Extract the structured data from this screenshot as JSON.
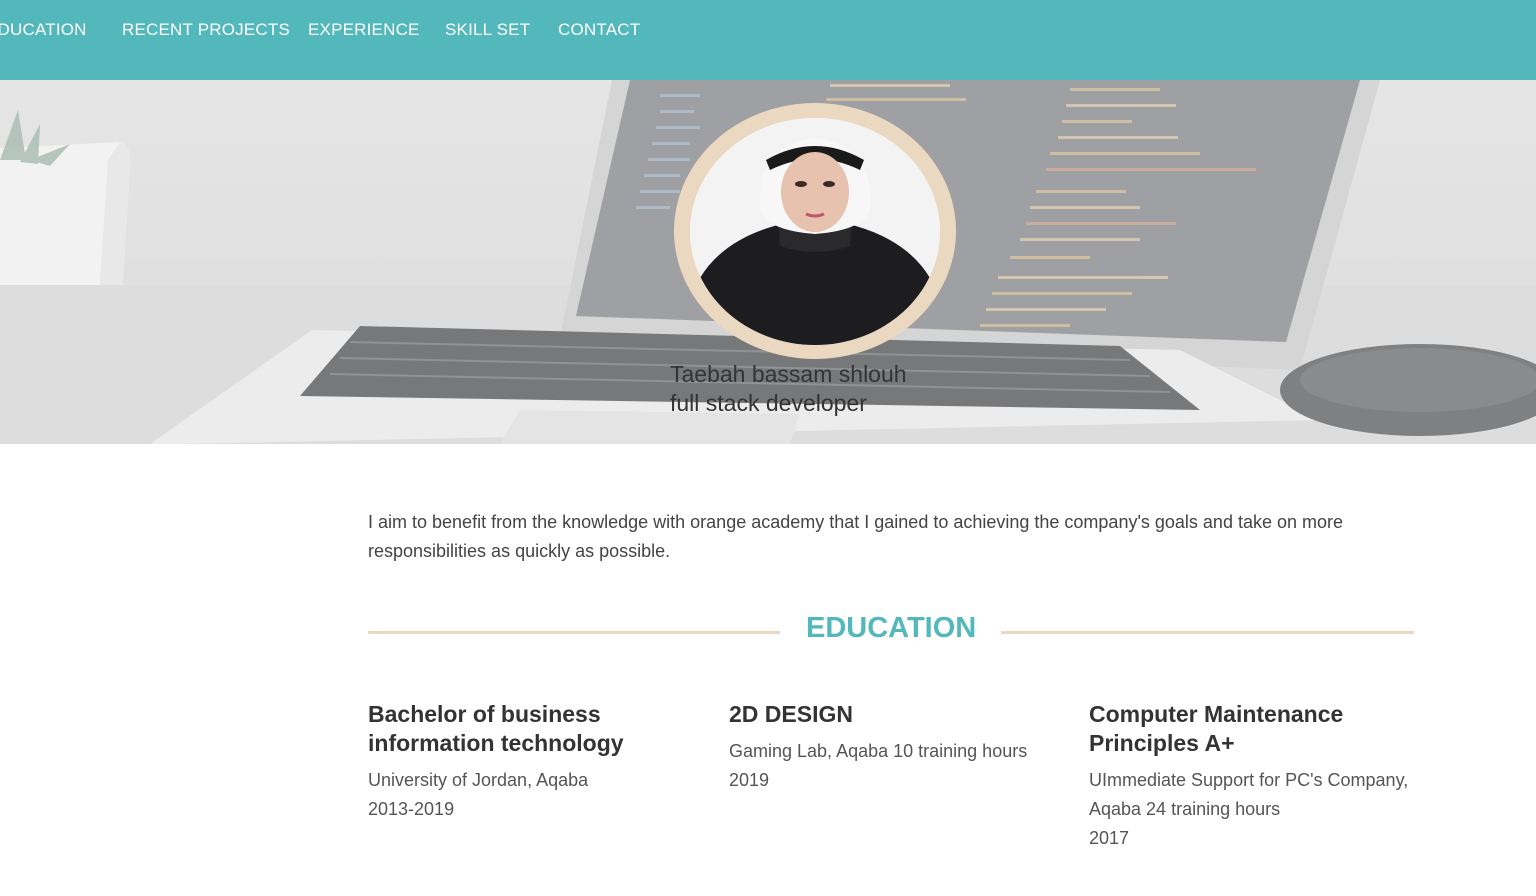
{
  "nav": {
    "items": [
      {
        "label": "EDUCATION"
      },
      {
        "label": "RECENT PROJECTS"
      },
      {
        "label": "EXPERIENCE"
      },
      {
        "label": "SKILL SET"
      },
      {
        "label": "CONTACT"
      }
    ]
  },
  "hero": {
    "name": "Taebah bassam shlouh",
    "role": "full stack developer"
  },
  "about": {
    "text": "I aim to benefit from the knowledge with orange academy that I gained to achieving the company's goals and take on more responsibilities as quickly as possible."
  },
  "education": {
    "title": "EDUCATION",
    "items": [
      {
        "title": "Bachelor of business information technology",
        "detail": "University of Jordan, Aqaba",
        "year": "2013-2019"
      },
      {
        "title": "2D DESIGN",
        "detail": "Gaming Lab, Aqaba 10 training hours",
        "year": "2019"
      },
      {
        "title": "Computer Maintenance Principles A+",
        "detail": "UImmediate Support for PC's Company, Aqaba 24 training hours",
        "year": "2017"
      }
    ]
  },
  "colors": {
    "nav_background": "#53b8bb",
    "accent": "#53b8bb",
    "rule": "#ead8c0"
  }
}
